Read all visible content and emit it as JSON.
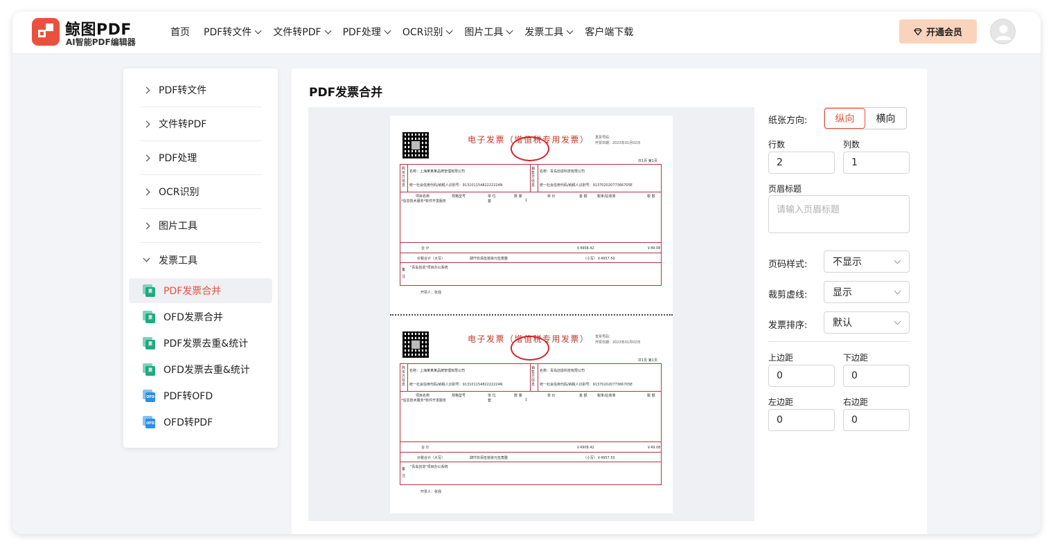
{
  "brand": {
    "name": "鲸图PDF",
    "subtitle": "AI智能PDF编辑器",
    "accent": "#e9513e"
  },
  "nav": {
    "items": [
      {
        "label": "首页",
        "dropdown": false
      },
      {
        "label": "PDF转文件",
        "dropdown": true
      },
      {
        "label": "文件转PDF",
        "dropdown": true
      },
      {
        "label": "PDF处理",
        "dropdown": true
      },
      {
        "label": "OCR识别",
        "dropdown": true
      },
      {
        "label": "图片工具",
        "dropdown": true
      },
      {
        "label": "发票工具",
        "dropdown": true
      },
      {
        "label": "客户端下载",
        "dropdown": false
      }
    ],
    "vip_label": "开通会员"
  },
  "sidebar": {
    "categories": [
      {
        "label": "PDF转文件",
        "expanded": false
      },
      {
        "label": "文件转PDF",
        "expanded": false
      },
      {
        "label": "PDF处理",
        "expanded": false
      },
      {
        "label": "OCR识别",
        "expanded": false
      },
      {
        "label": "图片工具",
        "expanded": false
      },
      {
        "label": "发票工具",
        "expanded": true
      }
    ],
    "sub_items": [
      {
        "label": "PDF发票合并",
        "icon": "invoice-green-icon",
        "icon_text": "票",
        "active": true
      },
      {
        "label": "OFD发票合并",
        "icon": "invoice-green-icon",
        "icon_text": "票",
        "active": false
      },
      {
        "label": "PDF发票去重&统计",
        "icon": "invoice-green-icon",
        "icon_text": "票",
        "active": false
      },
      {
        "label": "OFD发票去重&统计",
        "icon": "invoice-green-icon",
        "icon_text": "票",
        "active": false
      },
      {
        "label": "PDF转OFD",
        "icon": "ofd-blue-icon",
        "icon_text": "OFD",
        "active": false
      },
      {
        "label": "OFD转PDF",
        "icon": "ofd-blue-icon",
        "icon_text": "OFD",
        "active": false
      }
    ]
  },
  "main": {
    "title": "PDF发票合并"
  },
  "invoice": {
    "title": "电子发票（增值税专用发票）",
    "meta_lines": [
      "发票号码：",
      "开票日期：2023年01月02日"
    ],
    "page_no": "共1页 第1页",
    "buyer": "名称：上海某某某品牌管理有限公司",
    "buyer_tax": "统一社会信用代码/纳税人识别号：91310115482222224N",
    "seller": "名称：青岛创造科技有限公司",
    "seller_tax": "统一社会信用代码/纳税人识别号：91370202077366705E",
    "headers": [
      "项目名称",
      "规格型号",
      "单 位",
      "数 量",
      "单 价",
      "金 额",
      "税率/征收率",
      "税 额"
    ],
    "item_name": "*信息技术服务*软件开发服务",
    "unit": "套",
    "qty": "1",
    "sum_label": "合 计",
    "total_label": "价税合计（大写）",
    "total_cn": "肆仟玖佰伍拾柒元伍角整",
    "total_num": "（小写）￥4957.50",
    "amount_sum": "￥4908.42",
    "tax_sum": "￥49.08",
    "remark_label": "备注",
    "remark": "\"青岛创造\"项目办公系统",
    "issuer": "开票人：张强",
    "buyer_side": "购买方信息",
    "seller_side": "销售方信息"
  },
  "settings": {
    "orientation_label": "纸张方向:",
    "orientation_options": [
      "纵向",
      "横向"
    ],
    "orientation_selected": "纵向",
    "rows_label": "行数",
    "rows_value": "2",
    "cols_label": "列数",
    "cols_value": "1",
    "header_title_label": "页眉标题",
    "header_title_placeholder": "请输入页眉标题",
    "page_number_label": "页码样式:",
    "page_number_value": "不显示",
    "crop_line_label": "裁剪虚线:",
    "crop_line_value": "显示",
    "sort_label": "发票排序:",
    "sort_value": "默认",
    "margin_top_label": "上边距",
    "margin_top_value": "0",
    "margin_bottom_label": "下边距",
    "margin_bottom_value": "0",
    "margin_left_label": "左边距",
    "margin_left_value": "0",
    "margin_right_label": "右边距",
    "margin_right_value": "0"
  }
}
